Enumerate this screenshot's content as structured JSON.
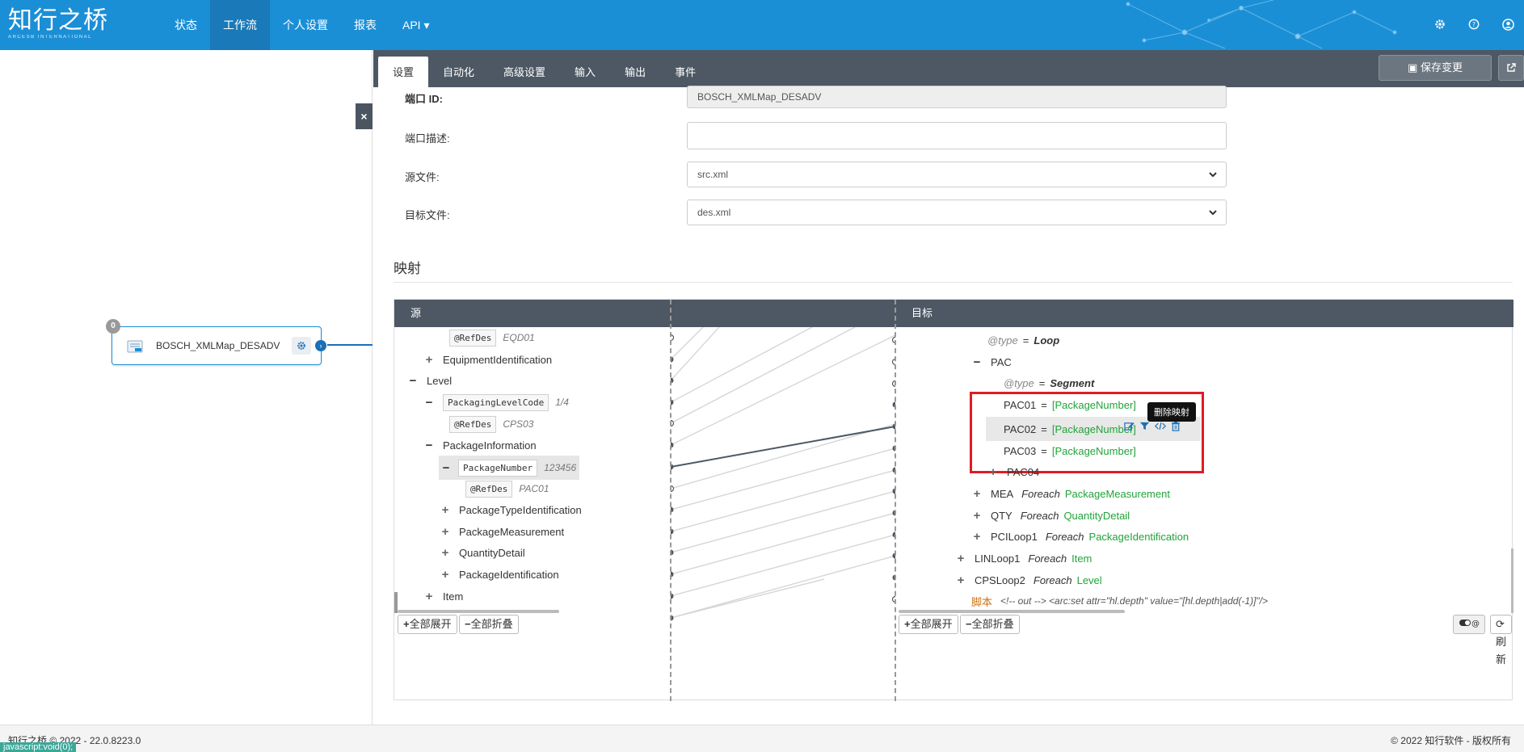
{
  "brand": {
    "name_cn": "知行之桥",
    "name_en": "ARCESB INTERNATIONAL"
  },
  "nav": {
    "items": [
      {
        "label": "状态"
      },
      {
        "label": "工作流"
      },
      {
        "label": "个人设置"
      },
      {
        "label": "报表"
      },
      {
        "label": "API ▾"
      }
    ],
    "active": "工作流",
    "right_icons": [
      "gear-icon",
      "help-icon",
      "user-icon"
    ]
  },
  "canvas": {
    "node": {
      "badge": "0",
      "label": "BOSCH_XMLMap_DESADV"
    },
    "close_label": "×"
  },
  "tabs": [
    {
      "label": "设置"
    },
    {
      "label": "自动化"
    },
    {
      "label": "高级设置"
    },
    {
      "label": "输入"
    },
    {
      "label": "输出"
    },
    {
      "label": "事件"
    }
  ],
  "save_label": "保存变更",
  "form": {
    "port_id_label": "端口 ID:",
    "port_id_value": "BOSCH_XMLMap_DESADV",
    "port_desc_label": "端口描述:",
    "port_desc_value": "",
    "source_label": "源文件:",
    "source_value": "src.xml",
    "target_label": "目标文件:",
    "target_value": "des.xml"
  },
  "mapping": {
    "title": "映射",
    "source_header": "源",
    "target_header": "目标",
    "source_tree": [
      {
        "tag": "@RefDes",
        "val": "EQD01"
      },
      {
        "text": "EquipmentIdentification"
      },
      {
        "text": "Level"
      },
      {
        "tag": "PackagingLevelCode",
        "val": "1/4"
      },
      {
        "tag": "@RefDes",
        "val": "CPS03"
      },
      {
        "text": "PackageInformation"
      },
      {
        "tag": "PackageNumber",
        "val": "123456"
      },
      {
        "tag": "@RefDes",
        "val": "PAC01"
      },
      {
        "text": "PackageTypeIdentification"
      },
      {
        "text": "PackageMeasurement"
      },
      {
        "text": "QuantityDetail"
      },
      {
        "text": "PackageIdentification"
      },
      {
        "text": "Item"
      }
    ],
    "target_tree": {
      "type_attr": "@type",
      "loop_val": "Loop",
      "pac": "PAC",
      "segment_val": "Segment",
      "pac01": "PAC01",
      "pac02": "PAC02",
      "pac03": "PAC03",
      "mapped_val": "[PackageNumber]",
      "pac04": "PAC04",
      "mea": "MEA",
      "mea_src": "PackageMeasurement",
      "qty": "QTY",
      "qty_src": "QuantityDetail",
      "pci": "PCILoop1",
      "pci_src": "PackageIdentification",
      "lin": "LINLoop1",
      "lin_src": "Item",
      "cps": "CPSLoop2",
      "cps_src": "Level",
      "foreach": "Foreach",
      "eq": "=",
      "script_label": "脚本",
      "script_text": "<!-- out --> <arc:set attr=\"hl.depth\" value=\"[hl.depth|add(-1)]\"/>"
    },
    "tooltip": "删除映射",
    "expand_all": "全部展开",
    "collapse_all": "全部折叠",
    "refresh": "刷新"
  },
  "footer": {
    "version": "知行之桥 © 2022 - 22.0.8223.0",
    "copyright": "© 2022 知行软件 - 版权所有",
    "status": "javascript:void(0);"
  }
}
